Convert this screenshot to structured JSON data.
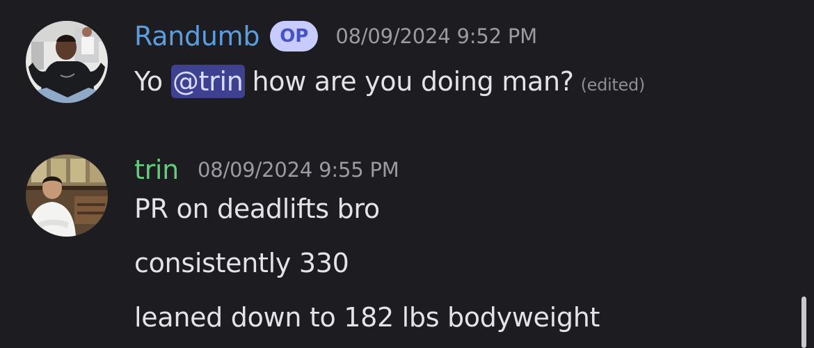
{
  "messages": [
    {
      "username": "Randumb",
      "badge": "OP",
      "timestamp": "08/09/2024 9:52 PM",
      "avatar_icon": "user-avatar-randumb",
      "text_before": "Yo",
      "mention": "@trin",
      "text_after": "how are you doing man?",
      "edited": "(edited)",
      "username_color": "#5b9ee0"
    },
    {
      "username": "trin",
      "timestamp": "08/09/2024 9:55 PM",
      "avatar_icon": "user-avatar-trin",
      "lines": [
        "PR on deadlifts bro",
        "consistently 330",
        "leaned down to 182 lbs bodyweight"
      ],
      "username_color": "#5fcf7b"
    }
  ],
  "colors": {
    "background": "#1d1d21",
    "mention_bg": "#3d418f",
    "badge_bg": "#c7cbfd",
    "badge_text": "#4752c4"
  }
}
